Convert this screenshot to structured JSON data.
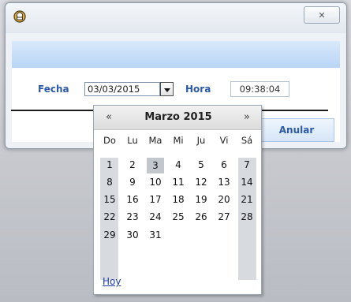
{
  "dialog": {
    "close_label": "✕",
    "fecha_label": "Fecha",
    "date_value": "03/03/2015",
    "hora_label": "Hora",
    "time_value": "09:38:04",
    "cancel_label": "Anular"
  },
  "calendar": {
    "prev": "«",
    "next": "»",
    "title": "Marzo 2015",
    "dow": [
      "Do",
      "Lu",
      "Ma",
      "Mi",
      "Ju",
      "Vi",
      "Sá"
    ],
    "weeks": [
      [
        "1",
        "2",
        "3",
        "4",
        "5",
        "6",
        "7"
      ],
      [
        "8",
        "9",
        "10",
        "11",
        "12",
        "13",
        "14"
      ],
      [
        "15",
        "16",
        "17",
        "18",
        "19",
        "20",
        "21"
      ],
      [
        "22",
        "23",
        "24",
        "25",
        "26",
        "27",
        "28"
      ],
      [
        "29",
        "30",
        "31",
        "",
        "",
        "",
        ""
      ]
    ],
    "selected_day": "3",
    "today_link": "Hoy"
  },
  "colors": {
    "accent_text": "#2a5aa8",
    "header_band": "#c7ddf7",
    "weekend_column": "#d7dbe0"
  },
  "icons": {
    "app": "chef-hat-icon",
    "close": "close-icon",
    "dropdown": "chevron-down-icon"
  }
}
